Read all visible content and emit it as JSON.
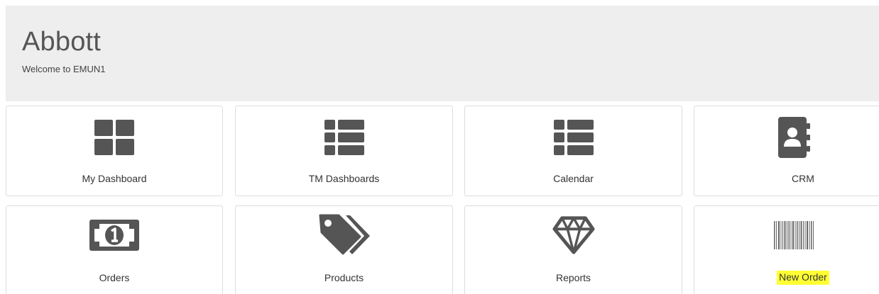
{
  "header": {
    "title": "Abbott",
    "subtitle": "Welcome to EMUN1"
  },
  "tiles": [
    {
      "label": "My Dashboard",
      "icon": "grid-icon"
    },
    {
      "label": "TM Dashboards",
      "icon": "list-icon"
    },
    {
      "label": "Calendar",
      "icon": "list-icon"
    },
    {
      "label": "CRM",
      "icon": "address-book-icon"
    },
    {
      "label": "Orders",
      "icon": "money-bill-icon"
    },
    {
      "label": "Products",
      "icon": "tags-icon"
    },
    {
      "label": "Reports",
      "icon": "diamond-icon"
    },
    {
      "label": "New Order",
      "icon": "barcode-icon",
      "highlighted": true
    }
  ],
  "colors": {
    "header_bg": "#eeeeee",
    "icon": "#555555",
    "highlight": "#ffff33",
    "tile_border": "#dddddd"
  }
}
